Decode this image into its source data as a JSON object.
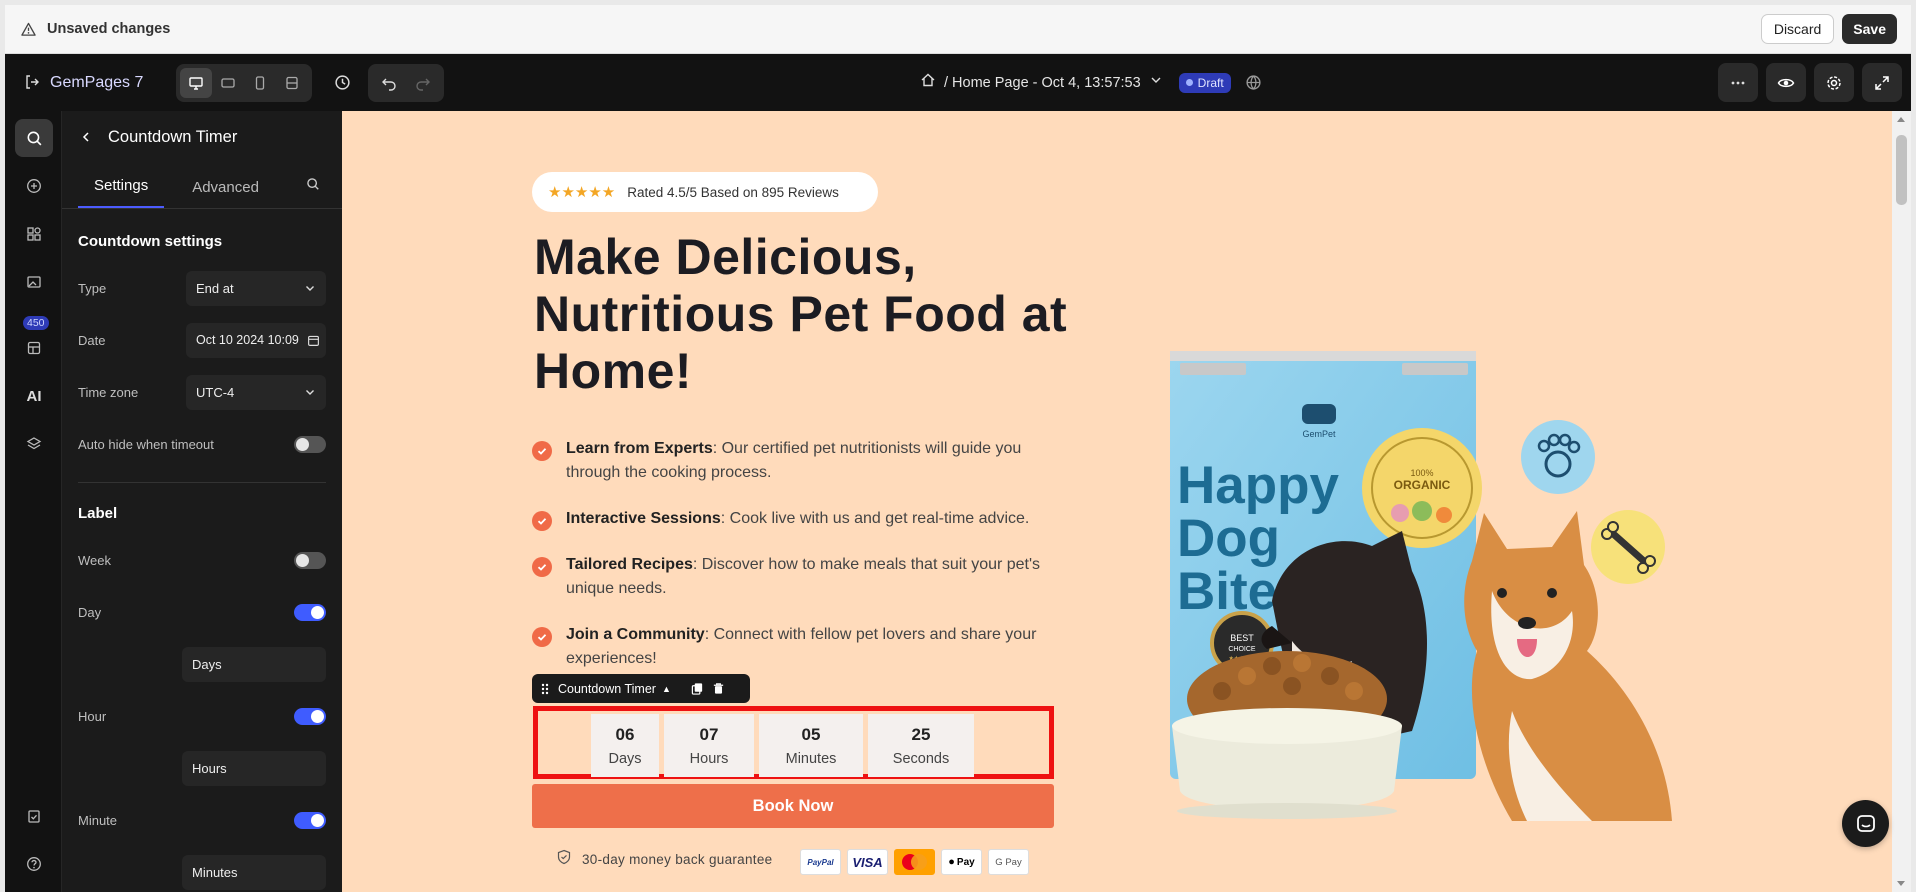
{
  "unsaved": {
    "text": "Unsaved changes",
    "discard_label": "Discard",
    "save_label": "Save"
  },
  "header": {
    "brand": "GemPages 7",
    "page_title": "/ Home Page - Oct 4, 13:57:53",
    "status_badge": "Draft"
  },
  "rail": {
    "badge_count": "450",
    "ai_label": "AI"
  },
  "panel": {
    "title": "Countdown Timer",
    "tabs": [
      "Settings",
      "Advanced"
    ],
    "countdown_settings_title": "Countdown settings",
    "type_label": "Type",
    "type_value": "End at",
    "date_label": "Date",
    "date_value": "Oct 10 2024 10:09",
    "timezone_label": "Time zone",
    "timezone_value": "UTC-4",
    "auto_hide_label": "Auto hide when timeout",
    "auto_hide_on": false,
    "label_section_title": "Label",
    "week_label": "Week",
    "week_on": false,
    "day_label": "Day",
    "day_on": true,
    "day_text": "Days",
    "hour_label": "Hour",
    "hour_on": true,
    "hour_text": "Hours",
    "minute_label": "Minute",
    "minute_on": true,
    "minute_text": "Minutes"
  },
  "canvas": {
    "rating_stars": "★★★★★",
    "rating_text": "Rated 4.5/5 Based on 895 Reviews",
    "hero_title": "Make Delicious, Nutritious Pet Food at Home!",
    "features": [
      {
        "bold": "Learn from Experts",
        "text": ": Our certified pet nutritionists will guide you through the cooking process."
      },
      {
        "bold": "Interactive Sessions",
        "text": ": Cook live with us and get real-time advice."
      },
      {
        "bold": "Tailored Recipes",
        "text": ": Discover how to make meals that suit your pet's unique needs."
      },
      {
        "bold": "Join a Community",
        "text": ": Connect with fellow pet lovers and share your experiences!"
      }
    ],
    "element_toolbar_label": "Countdown Timer",
    "countdown": [
      {
        "value": "06",
        "label": "Days"
      },
      {
        "value": "07",
        "label": "Hours"
      },
      {
        "value": "05",
        "label": "Minutes"
      },
      {
        "value": "25",
        "label": "Seconds"
      }
    ],
    "cta_label": "Book Now",
    "guarantee_text": "30-day money back guarantee",
    "payments": [
      "PayPal",
      "VISA",
      "MasterCard",
      "Pay",
      "G Pay"
    ],
    "product": {
      "brand": "GemPet",
      "name_line1": "Happy",
      "name_line2": "Dog",
      "name_line3": "Bites",
      "seal_small": "100%",
      "seal_big": "ORGANIC",
      "badge_line1": "BEST",
      "badge_line2": "CHOICE",
      "badge_stars": "★★★★★"
    }
  },
  "colors": {
    "accent": "#ee6f4a",
    "canvas_bg": "#ffdbbb",
    "highlight": "#ee1111",
    "toggle_on": "#3f5cff"
  }
}
